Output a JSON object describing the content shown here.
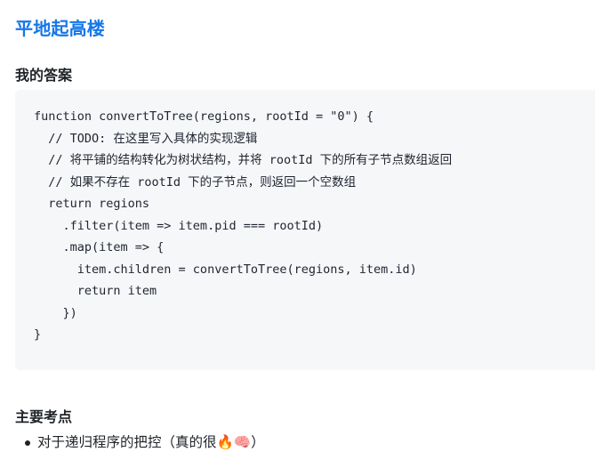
{
  "document": {
    "title": "平地起高楼",
    "title_color": "#1677e8",
    "background_color": "#ffffff"
  },
  "sections": {
    "answer": {
      "heading": "我的答案",
      "code_block": {
        "language": "javascript",
        "background_color": "#f6f7f9",
        "text_color": "#1f2430",
        "lines": [
          "function convertToTree(regions, rootId = \"0\") {",
          "  // TODO: 在这里写入具体的实现逻辑",
          "  // 将平铺的结构转化为树状结构，并将 rootId 下的所有子节点数组返回",
          "  // 如果不存在 rootId 下的子节点，则返回一个空数组",
          "  return regions",
          "    .filter(item => item.pid === rootId)",
          "    .map(item => {",
          "      item.children = convertToTree(regions, item.id)",
          "      return item",
          "    })",
          "}"
        ]
      }
    },
    "key_points": {
      "heading": "主要考点",
      "items": [
        {
          "text_before": "对于递归程序的把控（真的很",
          "emoji_fire": "🔥",
          "emoji_brain": "🧠",
          "text_after": "）"
        }
      ]
    }
  }
}
